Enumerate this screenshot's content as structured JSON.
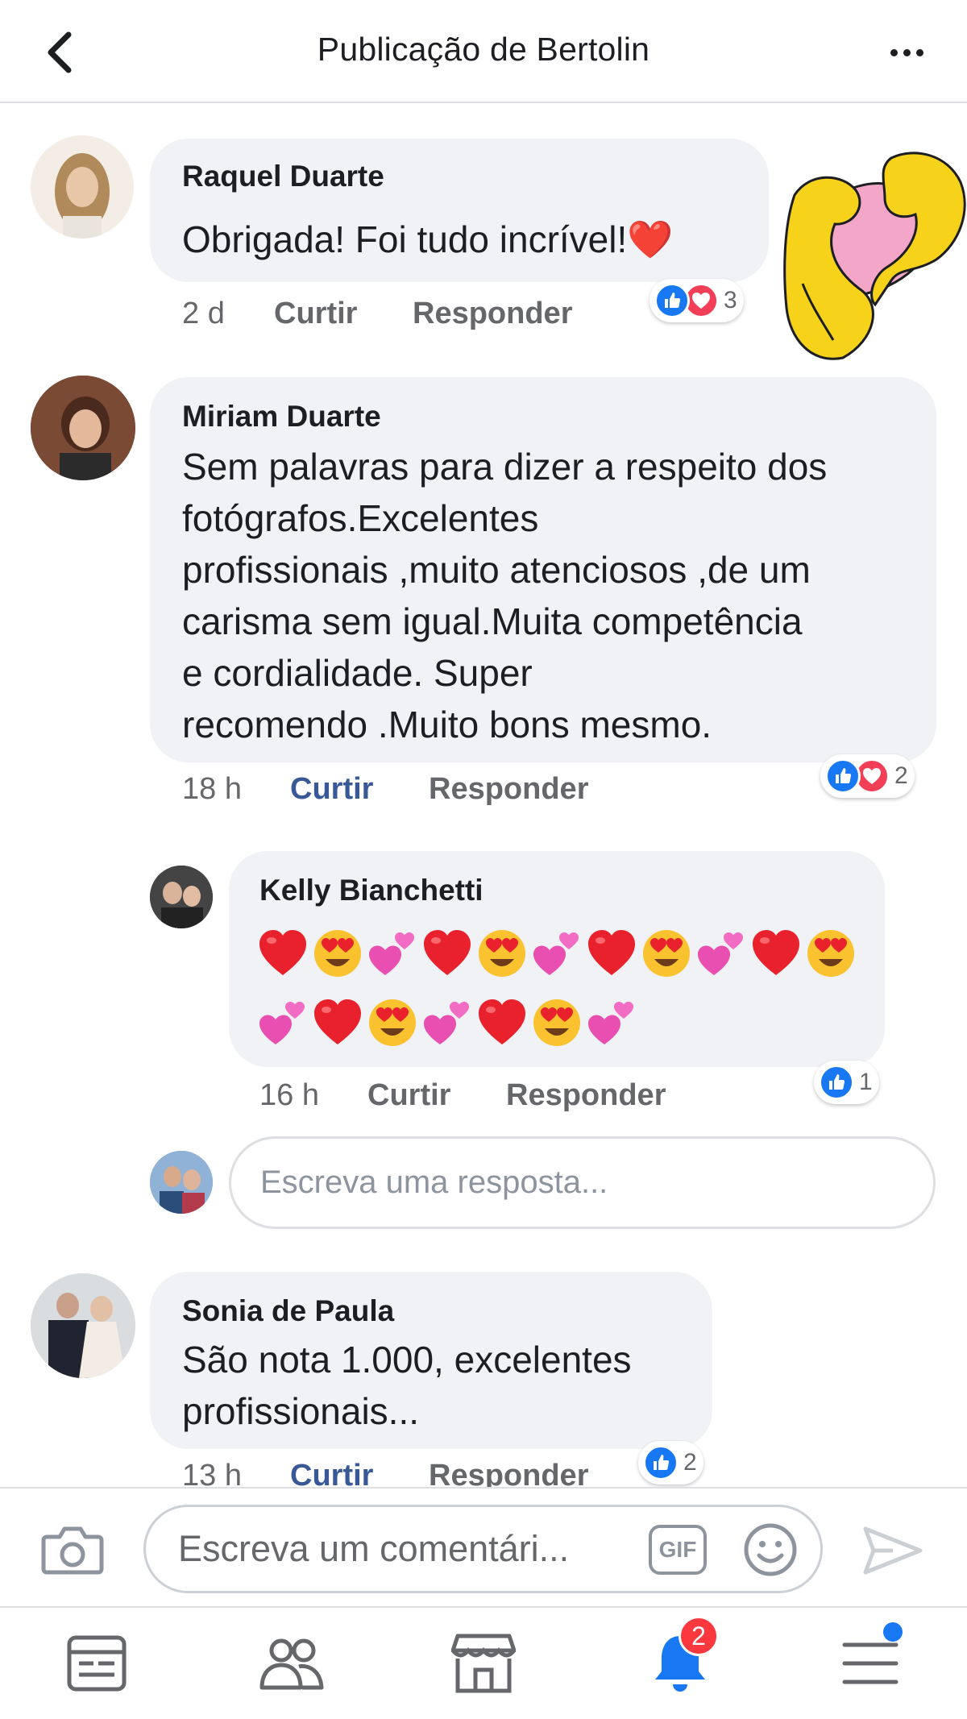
{
  "header": {
    "title": "Publicação de Bertolin",
    "back_icon": "chevron-left-icon",
    "more_icon": "more-horizontal-icon"
  },
  "comments": [
    {
      "author": "Raquel Duarte",
      "lines": [
        "Obrigada! Foi tudo incrível!❤️"
      ],
      "time": "2 d",
      "like_label": "Curtir",
      "reply_label": "Responder",
      "reactions": [
        "like",
        "love"
      ],
      "reaction_count": "3"
    },
    {
      "author": "Miriam Duarte",
      "lines": [
        "Sem palavras para dizer a respeito dos",
        "fotógrafos.Excelentes",
        "profissionais ,muito atenciosos ,de um",
        "carisma sem igual.Muita competência",
        "e cordialidade. Super",
        "recomendo .Muito bons mesmo."
      ],
      "time": "18 h",
      "like_label": "Curtir",
      "reply_label": "Responder",
      "liked": true,
      "reactions": [
        "like",
        "love"
      ],
      "reaction_count": "2"
    },
    {
      "author": "Sonia de Paula",
      "lines": [
        "São nota 1.000, excelentes",
        "profissionais..."
      ],
      "time": "13 h",
      "like_label": "Curtir",
      "reply_label": "Responder",
      "liked": true,
      "reactions": [
        "like"
      ],
      "reaction_count": "2"
    }
  ],
  "reply": {
    "author": "Kelly Bianchetti",
    "emoji_line_1": [
      "heart",
      "heart-eyes",
      "two-hearts",
      "heart",
      "heart-eyes",
      "two-hearts",
      "heart",
      "heart-eyes",
      "two-hearts",
      "heart",
      "heart-eyes"
    ],
    "emoji_line_2": [
      "two-hearts",
      "heart",
      "heart-eyes",
      "two-hearts",
      "heart",
      "heart-eyes",
      "two-hearts"
    ],
    "time": "16 h",
    "like_label": "Curtir",
    "reply_label": "Responder",
    "reactions": [
      "like"
    ],
    "reaction_count": "1"
  },
  "reply_input": {
    "placeholder": "Escreva uma resposta..."
  },
  "composer": {
    "placeholder": "Escreva um comentári...",
    "gif_label": "GIF",
    "camera_icon": "camera-icon",
    "smiley_icon": "smiley-icon",
    "send_icon": "send-icon"
  },
  "bottom_nav": {
    "items": [
      "news-feed-icon",
      "friends-icon",
      "marketplace-icon",
      "notifications-icon",
      "menu-icon"
    ],
    "notifications_badge": "2"
  },
  "colors": {
    "like_blue": "#1877f2",
    "love_red": "#f33e58",
    "link_blue": "#385898",
    "bubble_gray": "#f0f2f5",
    "heart_hands_yellow": "#f7d21b",
    "heart_hands_pink": "#f4a6c9"
  }
}
